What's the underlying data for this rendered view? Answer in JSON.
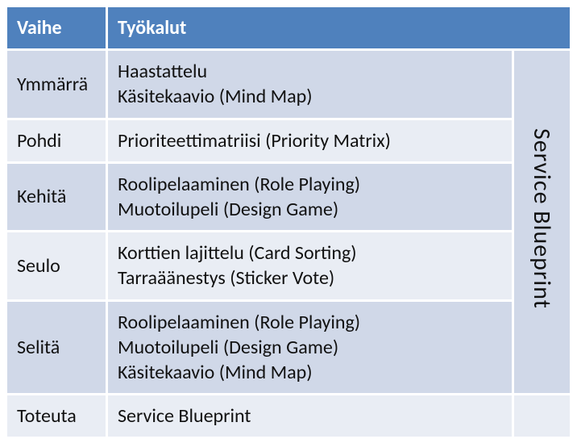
{
  "chart_data": {
    "type": "table",
    "columns": [
      "Vaihe",
      "Työkalut"
    ],
    "rows": [
      {
        "vaihe": "Ymmärrä",
        "tyokalut": [
          "Haastattelu",
          "Käsitekaavio (Mind Map)"
        ]
      },
      {
        "vaihe": "Pohdi",
        "tyokalut": [
          "Prioriteettimatriisi (Priority Matrix)"
        ]
      },
      {
        "vaihe": "Kehitä",
        "tyokalut": [
          "Roolipelaaminen (Role Playing)",
          "Muotoilupeli (Design Game)"
        ]
      },
      {
        "vaihe": "Seulo",
        "tyokalut": [
          "Korttien lajittelu (Card Sorting)",
          "Tarraäänestys (Sticker Vote)"
        ]
      },
      {
        "vaihe": "Selitä",
        "tyokalut": [
          "Roolipelaaminen (Role Playing)",
          "Muotoilupeli (Design Game)",
          "Käsitekaavio (Mind Map)"
        ]
      },
      {
        "vaihe": "Toteuta",
        "tyokalut": [
          "Service Blueprint"
        ]
      }
    ],
    "spanning_column": {
      "label": "Service Blueprint",
      "spans_rows": [
        "Ymmärrä",
        "Pohdi",
        "Kehitä",
        "Seulo",
        "Selitä"
      ]
    }
  },
  "header": {
    "vaihe": "Vaihe",
    "tyokalut": "Työkalut"
  },
  "rows": {
    "r0": {
      "vaihe": "Ymmärrä",
      "t0": "Haastattelu",
      "t1": "Käsitekaavio (Mind Map)"
    },
    "r1": {
      "vaihe": "Pohdi",
      "t0": "Prioriteettimatriisi (Priority Matrix)"
    },
    "r2": {
      "vaihe": "Kehitä",
      "t0": "Roolipelaaminen (Role Playing)",
      "t1": "Muotoilupeli (Design Game)"
    },
    "r3": {
      "vaihe": "Seulo",
      "t0": "Korttien lajittelu (Card Sorting)",
      "t1": "Tarraäänestys (Sticker Vote)"
    },
    "r4": {
      "vaihe": "Selitä",
      "t0": "Roolipelaaminen (Role Playing)",
      "t1": "Muotoilupeli (Design Game)",
      "t2": "Käsitekaavio (Mind Map)"
    },
    "r5": {
      "vaihe": "Toteuta",
      "t0": "Service Blueprint"
    }
  },
  "side_label": "Service Blueprint"
}
